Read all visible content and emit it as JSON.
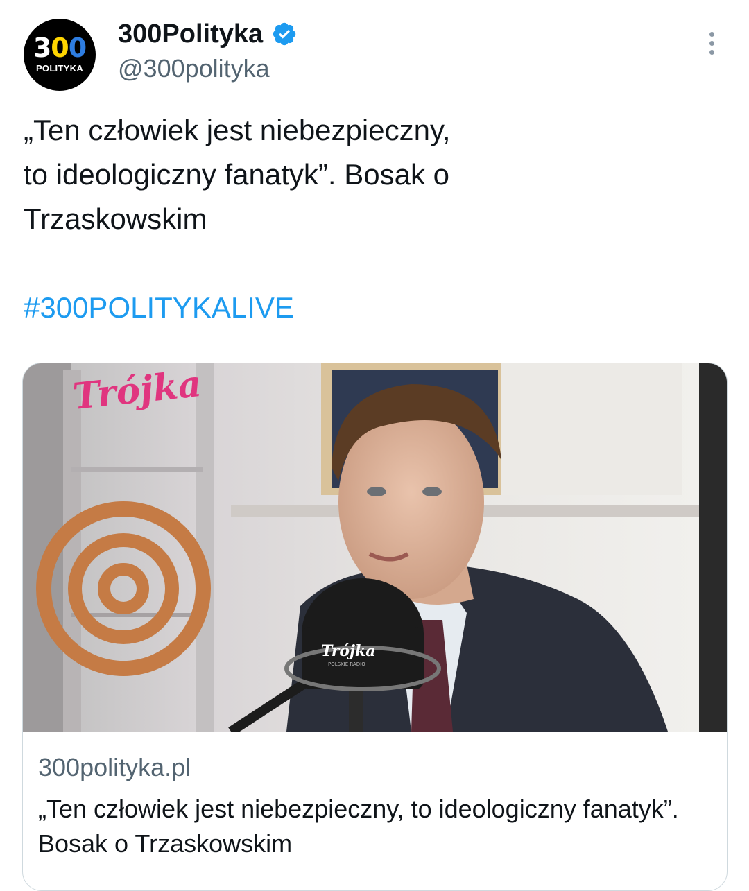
{
  "author": {
    "avatar": {
      "digits": [
        "3",
        "0",
        "0"
      ],
      "sub": "POLITYKA",
      "icon": "300polityka-logo"
    },
    "display_name": "300Polityka",
    "verified_icon": "verified-badge-icon",
    "handle": "@300polityka"
  },
  "more_icon": "more-options-icon",
  "tweet": {
    "lines": [
      "„Ten człowiek jest niebezpieczny,",
      "to ideologiczny fanatyk”. Bosak o",
      "Trzaskowskim"
    ],
    "hashtag": "#300POLITYKALIVE"
  },
  "card": {
    "image_logo_text": "Trójka",
    "mic_logo_text": "Trójka",
    "mic_logo_sub": "POLSKIE RADIO",
    "domain": "300polityka.pl",
    "title": "„Ten człowiek jest niebezpieczny, to ideologiczny fanatyk”. Bosak o Trzaskowskim"
  },
  "colors": {
    "link": "#1d9bf0",
    "secondary_text": "#536471",
    "border": "#cfd9de",
    "logo_pink": "#e0357f"
  }
}
